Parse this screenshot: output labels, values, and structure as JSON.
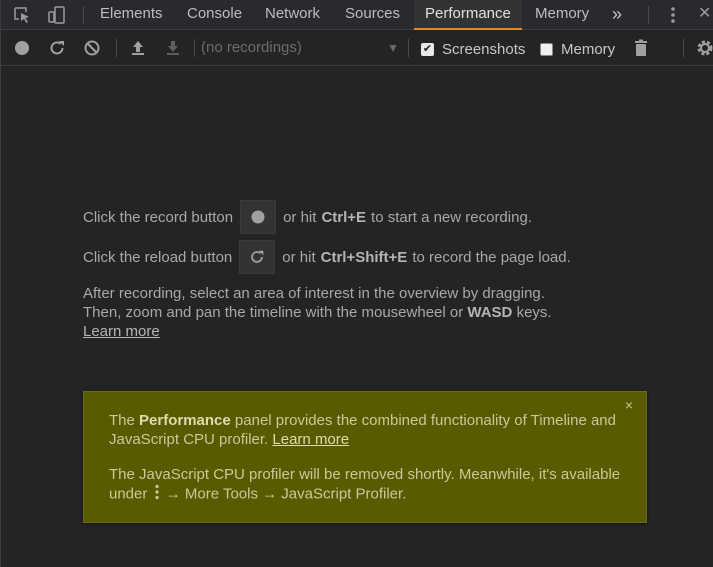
{
  "tabbar": {
    "tabs": [
      {
        "label": "Elements"
      },
      {
        "label": "Console"
      },
      {
        "label": "Network"
      },
      {
        "label": "Sources"
      },
      {
        "label": "Performance"
      },
      {
        "label": "Memory"
      }
    ],
    "active_tab": "Performance",
    "overflow_label": "»",
    "close_label": "✕",
    "accent_color": "#d98a2c"
  },
  "toolbar": {
    "recordings_placeholder": "(no recordings)",
    "screenshots_label": "Screenshots",
    "screenshots_checked": true,
    "memory_label": "Memory",
    "memory_checked": false
  },
  "landing": {
    "record_prefix": "Click the record button",
    "record_middle": "or hit",
    "record_shortcut": "Ctrl+E",
    "record_suffix": "to start a new recording.",
    "reload_prefix": "Click the reload button",
    "reload_middle": "or hit",
    "reload_shortcut": "Ctrl+Shift+E",
    "reload_suffix": "to record the page load.",
    "hint_line1": "After recording, select an area of interest in the overview by dragging.",
    "hint_line2_prefix": "Then, zoom and pan the timeline with the mousewheel or",
    "hint_keys": "WASD",
    "hint_line2_suffix": "keys.",
    "learn_more": "Learn more"
  },
  "promo": {
    "close_label": "×",
    "p1_prefix": "The",
    "p1_bold": "Performance",
    "p1_suffix": "panel provides the combined functionality of Timeline and JavaScript CPU profiler.",
    "p1_link": "Learn more",
    "p2_prefix": "The JavaScript CPU profiler will be removed shortly. Meanwhile, it's available under",
    "p2_suffix": "→ More Tools → JavaScript Profiler.",
    "background_color": "#5a5b00"
  }
}
